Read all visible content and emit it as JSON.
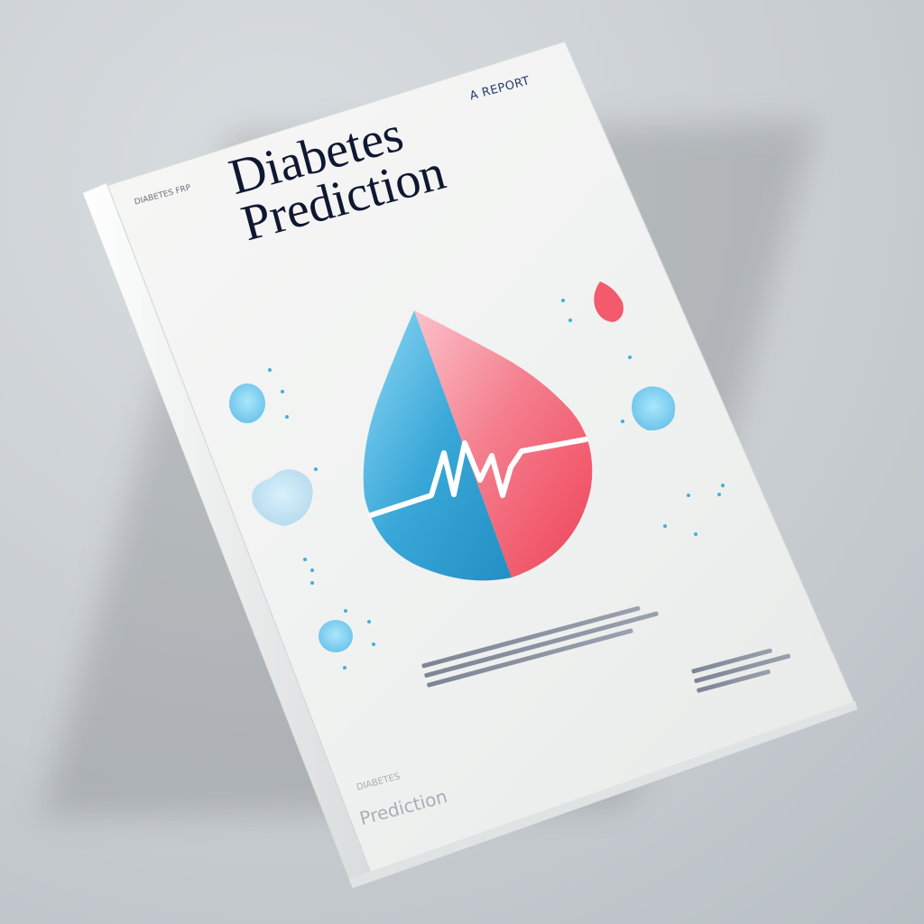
{
  "cover": {
    "label": "A REPORT",
    "title_line_1": "Diabetes",
    "title_line_2": "Prediction",
    "small_label_top": "DIABETES FRP",
    "footer_small": "DIABETES",
    "footer_title": "Prediction"
  },
  "colors": {
    "background": "#c9ced2",
    "cover": "#f2f3f2",
    "accent_blue": "#3ca8d8",
    "accent_red": "#f24b5e",
    "title": "#0f1830"
  },
  "icons": {
    "main_symbol": "blood-drop-heartbeat-icon",
    "decor_1": "blue-heart-icon",
    "decor_2": "red-drop-icon"
  }
}
